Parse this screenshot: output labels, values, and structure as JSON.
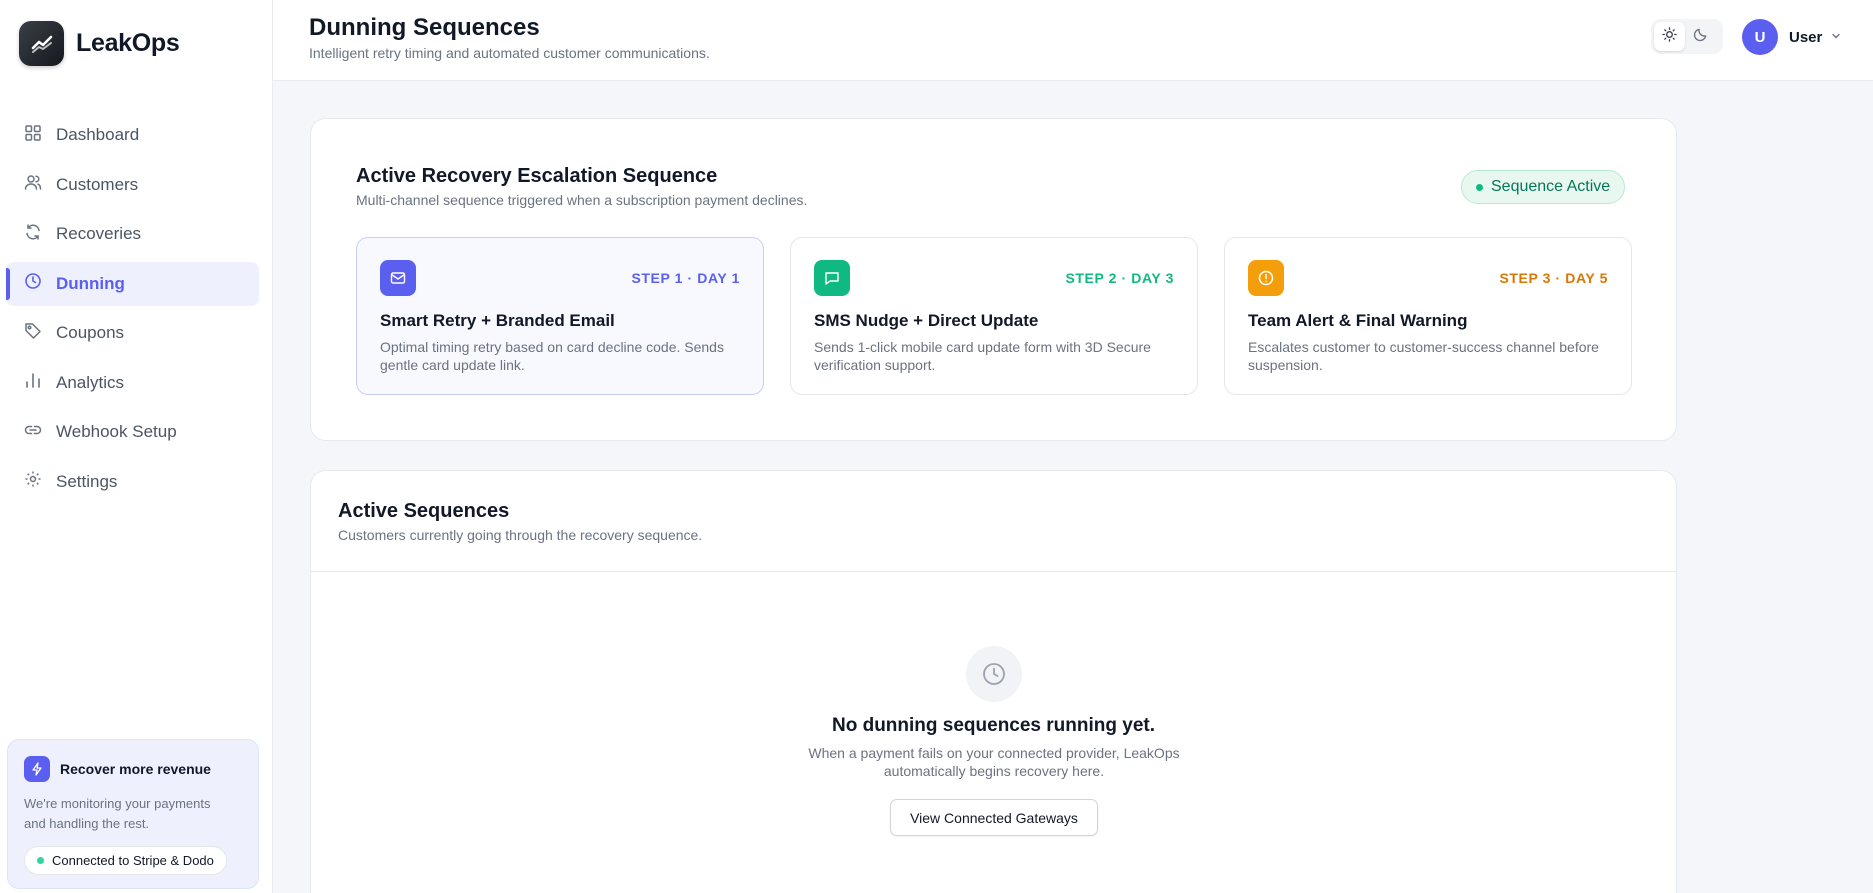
{
  "brand": {
    "name": "LeakOps"
  },
  "sidebar": {
    "items": [
      {
        "label": "Dashboard",
        "icon": "grid-icon",
        "active": false
      },
      {
        "label": "Customers",
        "icon": "users-icon",
        "active": false
      },
      {
        "label": "Recoveries",
        "icon": "refresh-icon",
        "active": false
      },
      {
        "label": "Dunning",
        "icon": "clock-icon",
        "active": true
      },
      {
        "label": "Coupons",
        "icon": "tag-icon",
        "active": false
      },
      {
        "label": "Analytics",
        "icon": "bar-chart-icon",
        "active": false
      },
      {
        "label": "Webhook Setup",
        "icon": "link-icon",
        "active": false
      },
      {
        "label": "Settings",
        "icon": "gear-icon",
        "active": false
      }
    ],
    "promo": {
      "title": "Recover more revenue",
      "text": "We're monitoring your payments and handling the rest.",
      "status": "Connected to Stripe & Dodo"
    }
  },
  "header": {
    "title": "Dunning Sequences",
    "subtitle": "Intelligent retry timing and automated customer communications.",
    "user": {
      "initial": "U",
      "name": "User"
    }
  },
  "sequence": {
    "title": "Active Recovery Escalation Sequence",
    "subtitle": "Multi-channel sequence triggered when a subscription payment declines.",
    "status": "Sequence Active",
    "steps": [
      {
        "tag": "STEP 1 · DAY 1",
        "title": "Smart Retry + Branded Email",
        "description": "Optimal timing retry based on card decline code. Sends gentle card update link.",
        "color": "#5b5ff0",
        "icon": "mail-icon"
      },
      {
        "tag": "STEP 2 · DAY 3",
        "title": "SMS Nudge + Direct Update",
        "description": "Sends 1-click mobile card update form with 3D Secure verification support.",
        "color": "#10b981",
        "icon": "message-icon"
      },
      {
        "tag": "STEP 3 · DAY 5",
        "title": "Team Alert & Final Warning",
        "description": "Escalates customer to customer-success channel before suspension.",
        "color": "#f59e0b",
        "icon": "alert-icon"
      }
    ]
  },
  "active_sequences": {
    "title": "Active Sequences",
    "subtitle": "Customers currently going through the recovery sequence.",
    "empty_title": "No dunning sequences running yet.",
    "empty_text": "When a payment fails on your connected provider, LeakOps automatically begins recovery here.",
    "button_label": "View Connected Gateways"
  },
  "colors": {
    "accent": "#5b5ff0",
    "success": "#10b981",
    "warning": "#f59e0b"
  }
}
